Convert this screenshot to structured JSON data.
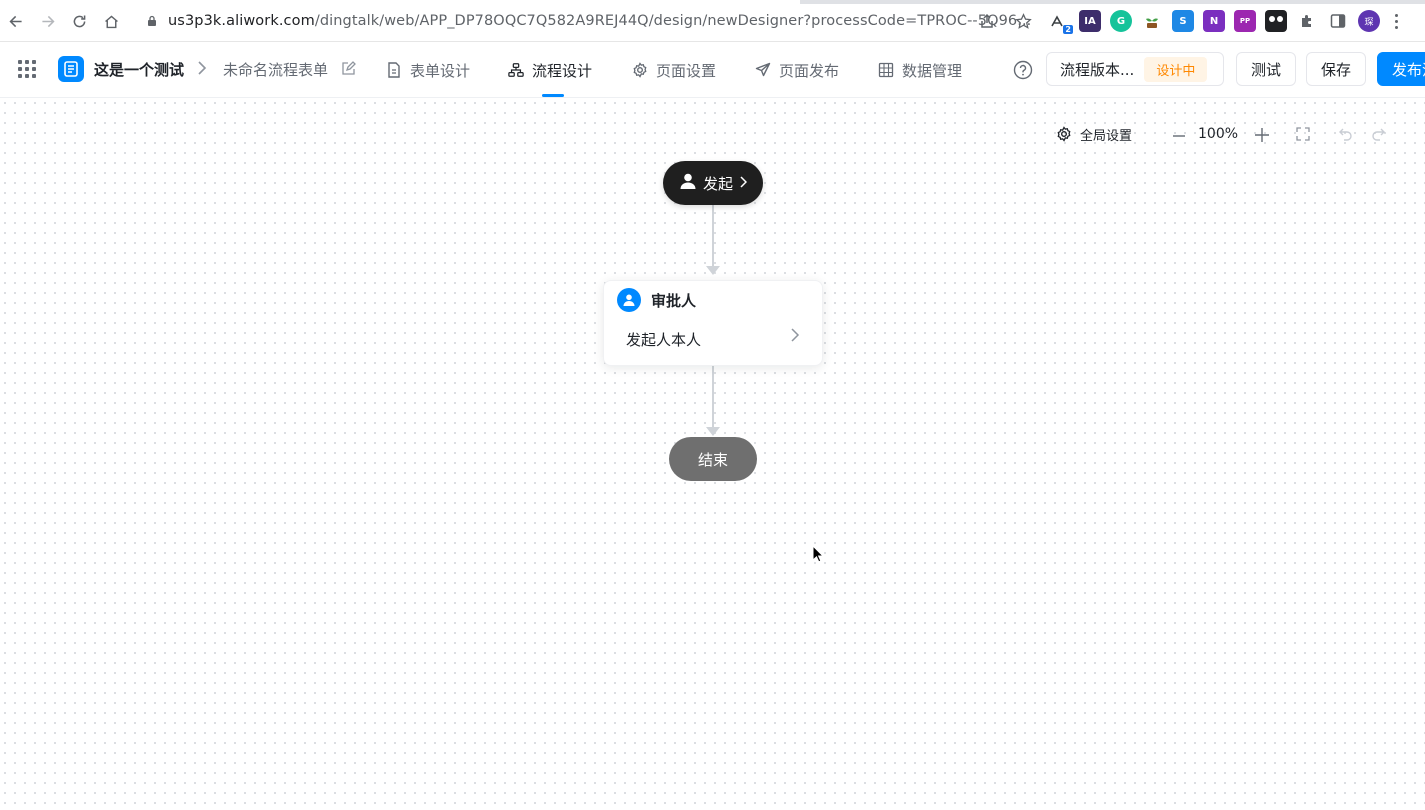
{
  "browser": {
    "url_host": "us3p3k.aliwork.com",
    "url_path": "/dingtalk/web/APP_DP78OQC7Q582A9REJ44Q/design/newDesigner?processCode=TPROC--5Q96...",
    "ext_badge": "2",
    "ext_ia_label": "IA",
    "ext_g_label": "G",
    "ext_s_label": "S",
    "ext_n_label": "N",
    "ext_pp_label": "PP",
    "avatar_label": "琛"
  },
  "header": {
    "app_name": "这是一个测试",
    "form_name": "未命名流程表单",
    "tabs": [
      {
        "label": "表单设计",
        "icon": "document-icon"
      },
      {
        "label": "流程设计",
        "icon": "flow-icon"
      },
      {
        "label": "页面设置",
        "icon": "gear-icon"
      },
      {
        "label": "页面发布",
        "icon": "send-icon"
      },
      {
        "label": "数据管理",
        "icon": "table-icon"
      }
    ],
    "active_tab": "流程设计",
    "version_label": "流程版本...",
    "version_status": "设计中",
    "test_label": "测试",
    "save_label": "保存",
    "publish_label": "发布流程"
  },
  "toolbar": {
    "global_settings": "全局设置",
    "zoom": "100%"
  },
  "flow": {
    "start_label": "发起",
    "approver_title": "审批人",
    "approver_value": "发起人本人",
    "end_label": "结束"
  },
  "colors": {
    "accent": "#0089ff",
    "status_orange": "#ff8800",
    "start_node": "#1f1f1f",
    "end_node": "#6f6f6f"
  }
}
